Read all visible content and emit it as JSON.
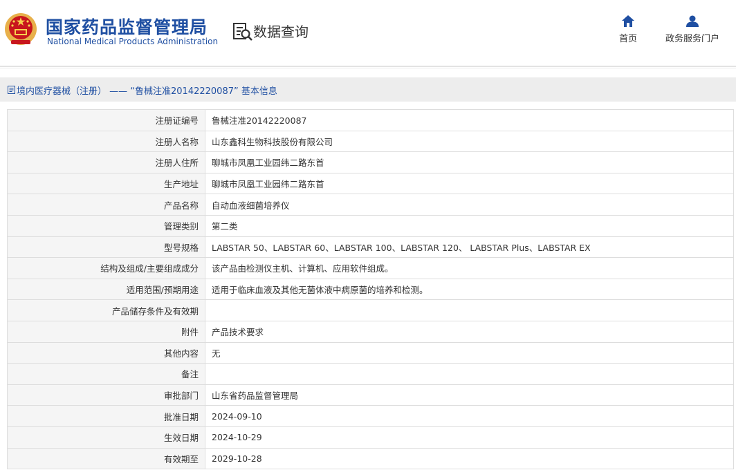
{
  "header": {
    "org_name_cn": "国家药品监督管理局",
    "org_name_en": "National Medical Products Administration",
    "query_title": "数据查询",
    "nav": {
      "home_label": "首页",
      "portal_label": "政务服务门户"
    }
  },
  "breadcrumb": {
    "text": "境内医疗器械（注册） —— “鲁械注准20142220087” 基本信息"
  },
  "colors": {
    "brand_blue": "#1f4fa2",
    "emblem_red": "#c8161d",
    "emblem_gold": "#e8b04a",
    "label_bg": "#f5f5f5",
    "breadcrumb_bg": "#ededed"
  },
  "icons": {
    "emblem": "national-emblem",
    "query": "search-document-icon",
    "home": "home-icon",
    "portal": "user-icon",
    "breadcrumb": "document-icon"
  },
  "records": [
    {
      "label": "注册证编号",
      "value": "鲁械注准20142220087"
    },
    {
      "label": "注册人名称",
      "value": "山东鑫科生物科技股份有限公司"
    },
    {
      "label": "注册人住所",
      "value": "聊城市凤凰工业园纬二路东首"
    },
    {
      "label": "生产地址",
      "value": "聊城市凤凰工业园纬二路东首"
    },
    {
      "label": "产品名称",
      "value": "自动血液细菌培养仪"
    },
    {
      "label": "管理类别",
      "value": "第二类"
    },
    {
      "label": "型号规格",
      "value": "LABSTAR 50、LABSTAR 60、LABSTAR 100、LABSTAR 120、 LABSTAR Plus、LABSTAR EX"
    },
    {
      "label": "结构及组成/主要组成成分",
      "value": "该产品由检测仪主机、计算机、应用软件组成。"
    },
    {
      "label": "适用范围/预期用途",
      "value": "适用于临床血液及其他无菌体液中病原菌的培养和检测。"
    },
    {
      "label": "产品储存条件及有效期",
      "value": ""
    },
    {
      "label": "附件",
      "value": "产品技术要求"
    },
    {
      "label": "其他内容",
      "value": "无"
    },
    {
      "label": "备注",
      "value": ""
    },
    {
      "label": "审批部门",
      "value": "山东省药品监督管理局"
    },
    {
      "label": "批准日期",
      "value": "2024-09-10"
    },
    {
      "label": "生效日期",
      "value": "2024-10-29"
    },
    {
      "label": "有效期至",
      "value": "2029-10-28"
    }
  ]
}
